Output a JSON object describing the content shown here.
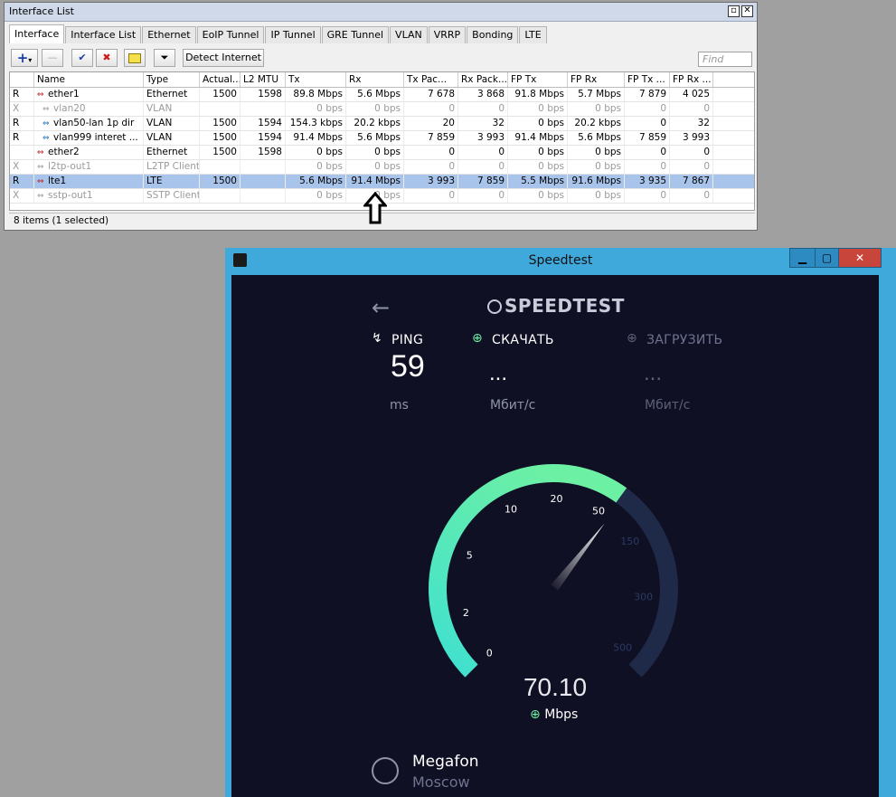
{
  "iflist": {
    "title": "Interface List",
    "tabs": [
      "Interface",
      "Interface List",
      "Ethernet",
      "EoIP Tunnel",
      "IP Tunnel",
      "GRE Tunnel",
      "VLAN",
      "VRRP",
      "Bonding",
      "LTE"
    ],
    "detect_label": "Detect Internet",
    "find_placeholder": "Find",
    "columns": [
      "",
      "Name",
      "Type",
      "Actual...",
      "L2 MTU",
      "Tx",
      "Rx",
      "Tx Pac...",
      "Rx Pack...",
      "FP Tx",
      "FP Rx",
      "FP Tx ...",
      "FP Rx ..."
    ],
    "rows": [
      {
        "flag": "R",
        "name": "ether1",
        "type": "Ethernet",
        "actual": "1500",
        "l2mtu": "1598",
        "tx": "89.8 Mbps",
        "rx": "5.6 Mbps",
        "txp": "7 678",
        "rxp": "3 868",
        "fptx": "91.8 Mbps",
        "fprx": "5.7 Mbps",
        "fptxp": "7 879",
        "fprxp": "4 025"
      },
      {
        "flag": "X",
        "name": "vlan20",
        "type": "VLAN",
        "actual": "",
        "l2mtu": "",
        "tx": "0 bps",
        "rx": "0 bps",
        "txp": "0",
        "rxp": "0",
        "fptx": "0 bps",
        "fprx": "0 bps",
        "fptxp": "0",
        "fprxp": "0"
      },
      {
        "flag": "R",
        "name": "vlan50-lan 1p dir",
        "type": "VLAN",
        "actual": "1500",
        "l2mtu": "1594",
        "tx": "154.3 kbps",
        "rx": "20.2 kbps",
        "txp": "20",
        "rxp": "32",
        "fptx": "0 bps",
        "fprx": "20.2 kbps",
        "fptxp": "0",
        "fprxp": "32"
      },
      {
        "flag": "R",
        "name": "vlan999 interet ...",
        "type": "VLAN",
        "actual": "1500",
        "l2mtu": "1594",
        "tx": "91.4 Mbps",
        "rx": "5.6 Mbps",
        "txp": "7 859",
        "rxp": "3 993",
        "fptx": "91.4 Mbps",
        "fprx": "5.6 Mbps",
        "fptxp": "7 859",
        "fprxp": "3 993"
      },
      {
        "flag": "",
        "name": "ether2",
        "type": "Ethernet",
        "actual": "1500",
        "l2mtu": "1598",
        "tx": "0 bps",
        "rx": "0 bps",
        "txp": "0",
        "rxp": "0",
        "fptx": "0 bps",
        "fprx": "0 bps",
        "fptxp": "0",
        "fprxp": "0"
      },
      {
        "flag": "X",
        "name": "l2tp-out1",
        "type": "L2TP Client",
        "actual": "",
        "l2mtu": "",
        "tx": "0 bps",
        "rx": "0 bps",
        "txp": "0",
        "rxp": "0",
        "fptx": "0 bps",
        "fprx": "0 bps",
        "fptxp": "0",
        "fprxp": "0"
      },
      {
        "flag": "R",
        "name": "lte1",
        "type": "LTE",
        "actual": "1500",
        "l2mtu": "",
        "tx": "5.6 Mbps",
        "rx": "91.4 Mbps",
        "txp": "3 993",
        "rxp": "7 859",
        "fptx": "5.5 Mbps",
        "fprx": "91.6 Mbps",
        "fptxp": "3 935",
        "fprxp": "7 867"
      },
      {
        "flag": "X",
        "name": "sstp-out1",
        "type": "SSTP Client",
        "actual": "",
        "l2mtu": "",
        "tx": "0 bps",
        "rx": "0 bps",
        "txp": "0",
        "rxp": "0",
        "fptx": "0 bps",
        "fprx": "0 bps",
        "fptxp": "0",
        "fprxp": "0"
      }
    ],
    "selected_index": 6,
    "status": "8 items (1 selected)"
  },
  "speedtest": {
    "title": "Speedtest",
    "logo": "SPEEDTEST",
    "ping_label": "PING",
    "ping_value": "59",
    "ping_unit": "ms",
    "download_label": "СКАЧАТЬ",
    "download_value": "...",
    "download_unit": "Мбит/с",
    "upload_label": "ЗАГРУЗИТЬ",
    "upload_value": "...",
    "upload_unit": "Мбит/с",
    "gauge_ticks": [
      "0",
      "2",
      "5",
      "10",
      "20",
      "50",
      "150",
      "300",
      "500"
    ],
    "current_speed": "70.10",
    "speed_unit": "Mbps",
    "isp": "Megafon",
    "city": "Moscow",
    "accent": "#6cf0a4",
    "track": "#1f2a48"
  }
}
